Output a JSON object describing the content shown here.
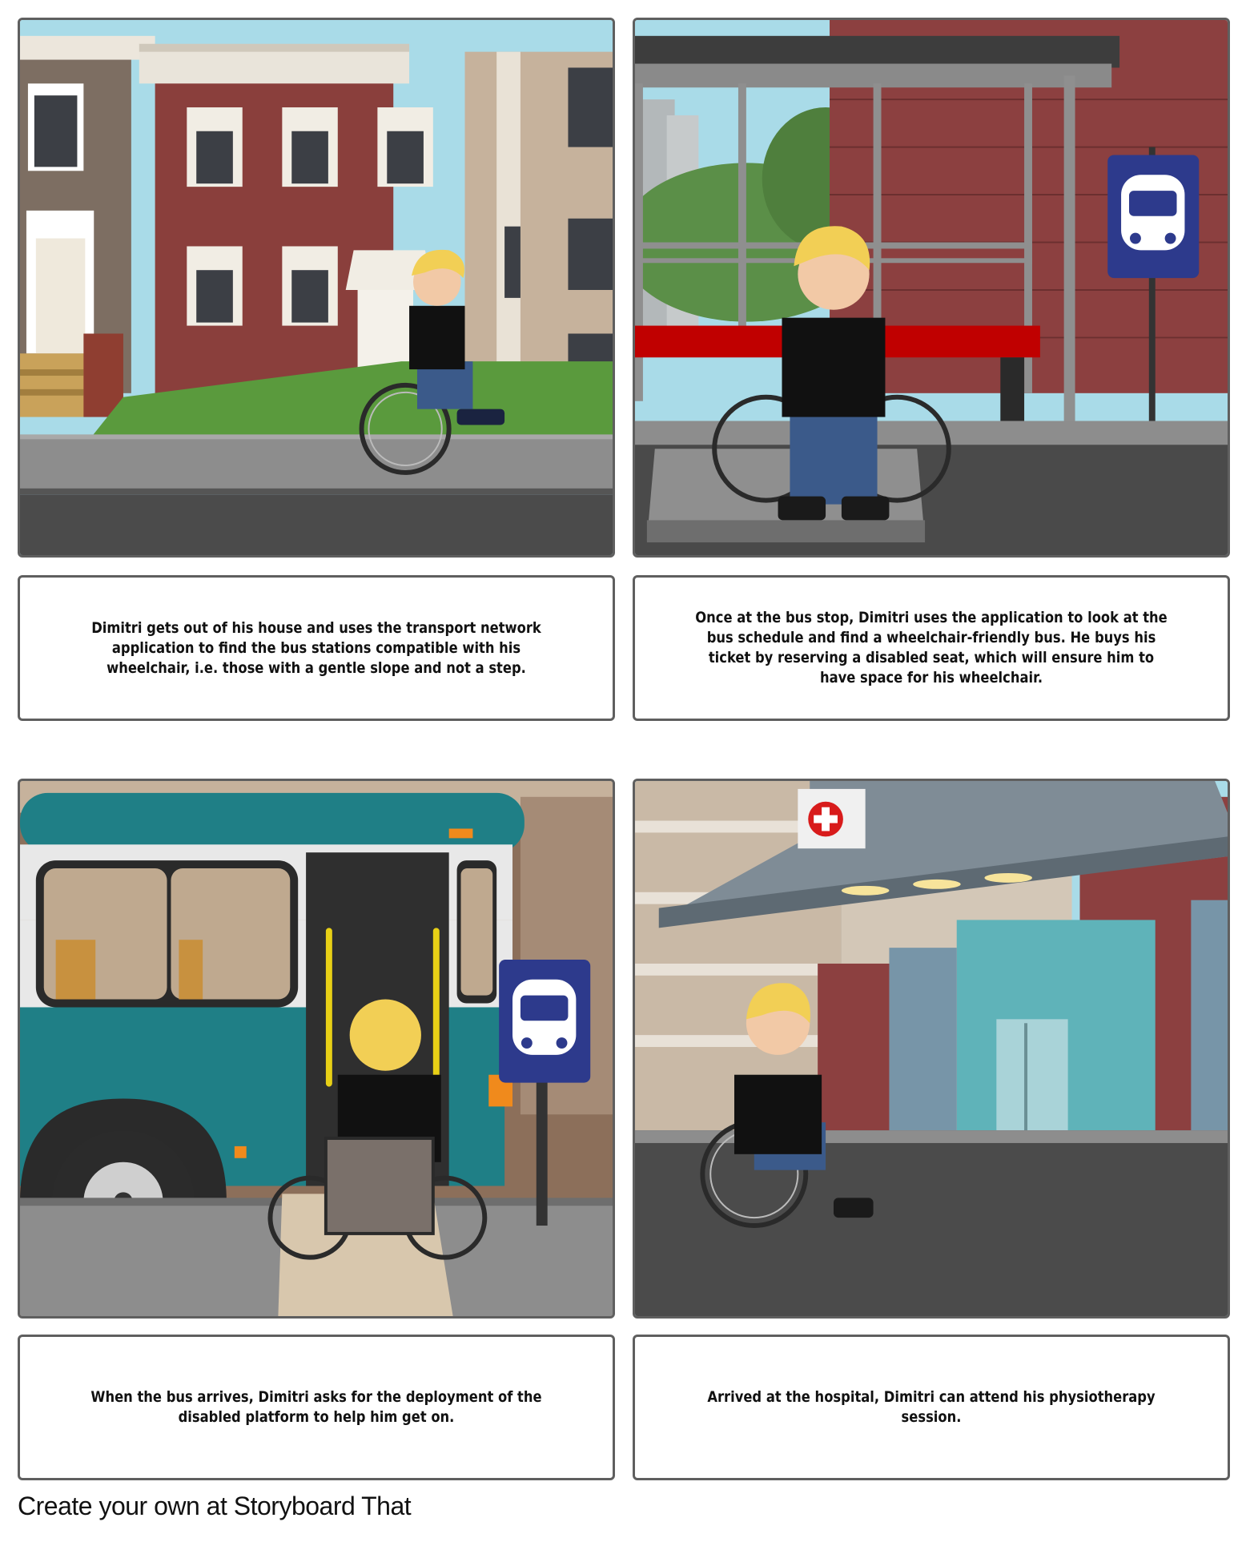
{
  "panels": [
    {
      "scene": "house",
      "caption": "Dimitri gets out of his house and uses the transport network application to find the bus stations compatible with his wheelchair, i.e. those with a gentle slope and not a step."
    },
    {
      "scene": "bus-stop",
      "caption": "Once at the bus stop, Dimitri uses the application to look at the bus schedule and find a wheelchair-friendly bus. He buys his ticket by reserving a disabled seat, which will ensure him to have space for his wheelchair."
    },
    {
      "scene": "bus-boarding",
      "caption": "When the bus arrives, Dimitri asks for the deployment of the disabled platform to help him get on."
    },
    {
      "scene": "hospital",
      "caption": "Arrived at the hospital, Dimitri can attend his physiotherapy session."
    }
  ],
  "footer": {
    "text": "Create your own at Storyboard That"
  },
  "icons": {
    "bus_sign": "bus-stop-sign-icon",
    "hospital_cross": "hospital-cross-icon"
  },
  "colors": {
    "brick": "#8a3f3c",
    "bus_teal": "#1f7f86",
    "sign_blue": "#2d3a8c",
    "bench_red": "#c00000",
    "hair": "#f2cf55"
  }
}
